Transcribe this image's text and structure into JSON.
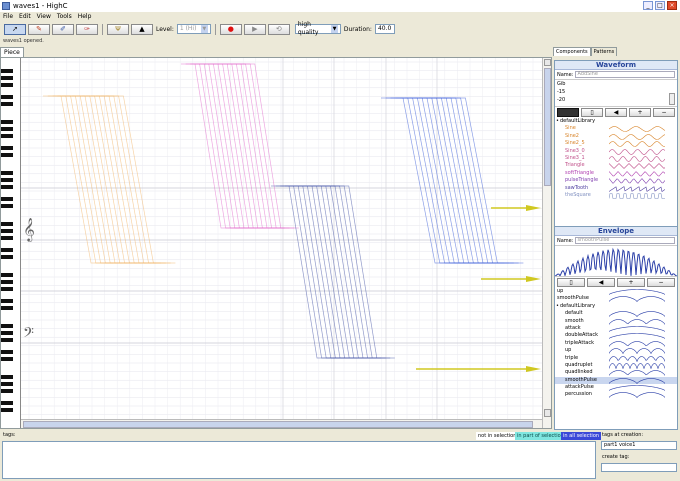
{
  "window": {
    "title": "waves1 - HighC",
    "controls": [
      "_",
      "□",
      "×"
    ]
  },
  "menu": [
    "File",
    "Edit",
    "View",
    "Tools",
    "Help"
  ],
  "toolbar": {
    "tool_icons": [
      "pointer-icon",
      "pencil-icon",
      "brush-icon",
      "eraser-icon",
      "tuning-fork-icon",
      "metronome-icon"
    ],
    "level_label": "Level:",
    "level_value": "1 (Hi)",
    "transport_icons": [
      "record-icon",
      "play-icon",
      "loop-icon"
    ],
    "quality_value": "high quality",
    "duration_label": "Duration:",
    "duration_value": "40.0"
  },
  "status_text": "waves1 opened.",
  "editor": {
    "tab_label": "Piece",
    "voice_colors": [
      "#f0b060",
      "#e060c8",
      "#3848a0",
      "#4060d8",
      "#d0c820"
    ]
  },
  "side": {
    "tabs": [
      "Components",
      "Patterns"
    ],
    "waveform": {
      "header": "Waveform",
      "name_label": "Name:",
      "name_value": "AddSine",
      "values": [
        "Gib",
        "-15",
        "-20"
      ],
      "tree": [
        {
          "label": "defaultLibrary",
          "root": true
        },
        {
          "label": "Sine",
          "color": "#d8842a"
        },
        {
          "label": "Sine2",
          "color": "#d8842a"
        },
        {
          "label": "Sine2_5",
          "color": "#d8842a"
        },
        {
          "label": "Sine3_0",
          "color": "#c0508a"
        },
        {
          "label": "Sine3_1",
          "color": "#c0508a"
        },
        {
          "label": "Triangle",
          "color": "#c0508a"
        },
        {
          "label": "softTriangle",
          "color": "#b040b0"
        },
        {
          "label": "pulseTriangle",
          "color": "#8040b0"
        },
        {
          "label": "sawTooth",
          "color": "#5040a0"
        },
        {
          "label": "theSquare",
          "color": "#8090c0"
        }
      ]
    },
    "envelope": {
      "header": "Envelope",
      "name_label": "Name:",
      "name_value": "smoothPulse",
      "tree": [
        {
          "label": "up",
          "root": false,
          "flat": true
        },
        {
          "label": "smoothPulse",
          "flat": true
        },
        {
          "label": "defaultLibrary",
          "root": true
        },
        {
          "label": "default"
        },
        {
          "label": "smooth"
        },
        {
          "label": "attack"
        },
        {
          "label": "doubleAttack"
        },
        {
          "label": "tripleAttack"
        },
        {
          "label": "up"
        },
        {
          "label": "triple"
        },
        {
          "label": "quadruplet"
        },
        {
          "label": "quadlinked"
        },
        {
          "label": "smoothPulse",
          "selected": true
        },
        {
          "label": "attackPulse"
        },
        {
          "label": "percussion"
        }
      ]
    }
  },
  "bottom": {
    "tags_label": "tags:",
    "legend": [
      {
        "label": "not in selection",
        "bg": "#ffffff",
        "fg": "#000000"
      },
      {
        "label": "in part of selection",
        "bg": "#7fe6e0",
        "fg": "#0a4a48"
      },
      {
        "label": "in all selection",
        "bg": "#3a48d8",
        "fg": "#ffffff"
      }
    ],
    "tags_at_creation_label": "tags at creation:",
    "tags_at_creation_value": "part1 voice1",
    "create_tag_label": "create tag:"
  }
}
